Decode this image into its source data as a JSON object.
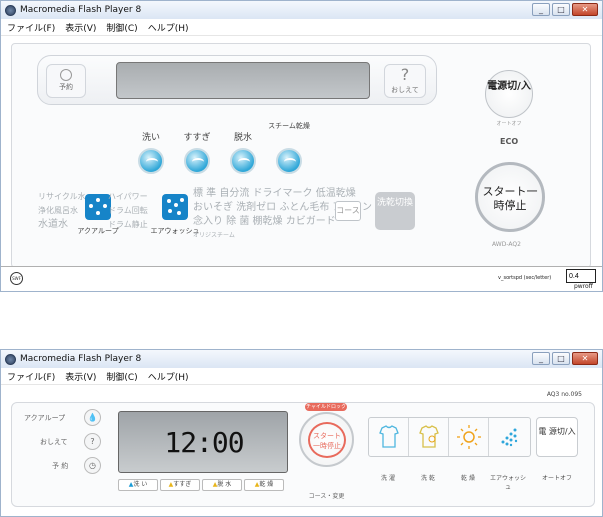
{
  "window1": {
    "title": "Macromedia Flash Player 8",
    "menu": [
      "ファイル(F)",
      "表示(V)",
      "制御(C)",
      "ヘルプ(H)"
    ],
    "timer_label": "予約",
    "help_label": "おしえて",
    "help_symbol": "?",
    "columns": [
      {
        "label": "洗い"
      },
      {
        "label": "すすぎ"
      },
      {
        "label": "脱水"
      },
      {
        "label": "スチーム乾燥"
      }
    ],
    "water_options": [
      "リサイクル水",
      "浄化風呂水",
      "水道水"
    ],
    "aqua_loop_label": "アクアループ",
    "wash_options": [
      "ハイパワー",
      "ドラム回転",
      "ドラム静止"
    ],
    "air_wash_label": "エアウォッシュ",
    "course_options_row1": "標 準 自分流 ドライマーク 低温乾燥",
    "course_options_row2": "おいそぎ 洗剤ゼロ ふとん毛布 アイロン",
    "course_options_row3": "念入り 除 菌 棚乾燥 カビガード",
    "course_options_row4": "オリジスチーム",
    "course_button": "コース",
    "dry_switch": "洗乾切換",
    "power": "電源切/入",
    "power_sub": "オートオフ",
    "eco_icon": "eco-icon",
    "start": "スタート一時停止",
    "model": "AWD-AQ2",
    "status_label": "v_sortspd (sec/letter)",
    "status_value": "0.4",
    "status_unit": "pwroff"
  },
  "window2": {
    "title": "Macromedia Flash Player 8",
    "menu": [
      "ファイル(F)",
      "表示(V)",
      "制御(C)",
      "ヘルプ(H)"
    ],
    "version": "AQ3 no.095",
    "left_buttons": [
      {
        "label": "アクアループ",
        "icon": "drop-icon"
      },
      {
        "label": "おしえて",
        "icon": "?"
      },
      {
        "label": "予 約",
        "icon": "clock-icon"
      }
    ],
    "time": "12:00",
    "modes": [
      "洗 い",
      "すすぎ",
      "脱 水",
      "乾 燥"
    ],
    "start_lock": "チャイルドロック",
    "start": "スタート一時停止",
    "start_sub": "コース・変更",
    "features": [
      "洗 濯",
      "洗 乾",
      "乾 燥",
      "エアウォッシュ"
    ],
    "power": "電 源切/入",
    "power_sub": "オートオフ"
  }
}
